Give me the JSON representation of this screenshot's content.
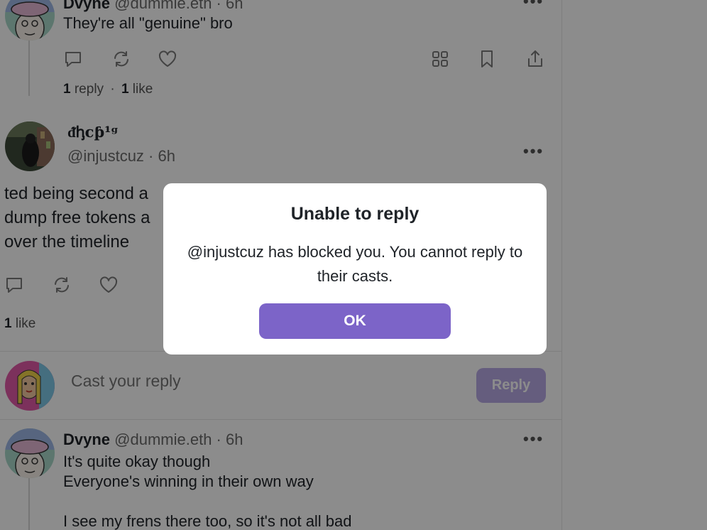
{
  "post1": {
    "display_name": "Dvyne",
    "username": "@dummie.eth · 6h",
    "text": "They're all \"genuine\" bro",
    "stats": {
      "replies_count": "1",
      "replies_label": "reply",
      "sep": "·",
      "likes_count": "1",
      "likes_label": "like"
    }
  },
  "post2": {
    "display_name": "ᵭꞕcƥ¹ᵍ",
    "username": "@injustcuz · 6h",
    "text": "ted being second a\ndump free tokens a\nover the timeline",
    "stats": {
      "likes_count": "1",
      "likes_label": "like"
    }
  },
  "reply_box": {
    "placeholder": "Cast your reply",
    "button_label": "Reply"
  },
  "post3": {
    "display_name": "Dvyne",
    "username": "@dummie.eth · 6h",
    "text": "It's quite okay though\nEveryone's winning in their own way\n\nI see my frens there too, so it's not all bad"
  },
  "modal": {
    "title": "Unable to reply",
    "message": "@injustcuz has blocked you. You cannot reply to their casts.",
    "ok_label": "OK"
  },
  "colors": {
    "accent": "#7c64c8",
    "accent_disabled": "#b9a9e6",
    "overlay": "rgba(0,0,0,0.45)"
  },
  "icons": [
    "comment-icon",
    "recast-icon",
    "heart-icon",
    "grid-icon",
    "bookmark-icon",
    "share-icon",
    "more-icon"
  ]
}
